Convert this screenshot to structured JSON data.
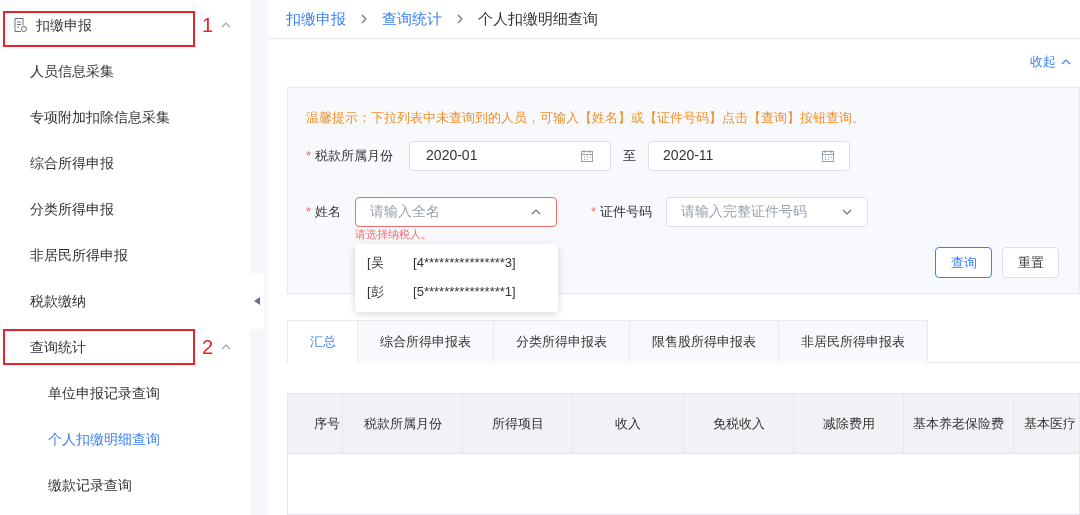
{
  "sidebar": {
    "items": [
      {
        "label": "扣缴申报",
        "expanded": true,
        "selected": false,
        "annotation": "1",
        "children": [
          {
            "label": "人员信息采集",
            "selected": false
          },
          {
            "label": "专项附加扣除信息采集",
            "selected": false
          },
          {
            "label": "综合所得申报",
            "selected": false
          },
          {
            "label": "分类所得申报",
            "selected": false
          },
          {
            "label": "非居民所得申报",
            "selected": false
          },
          {
            "label": "税款缴纳",
            "selected": false
          },
          {
            "label": "查询统计",
            "expanded": true,
            "selected": false,
            "annotation": "2",
            "children": [
              {
                "label": "单位申报记录查询",
                "selected": false
              },
              {
                "label": "个人扣缴明细查询",
                "selected": true
              },
              {
                "label": "缴款记录查询",
                "selected": false
              }
            ]
          }
        ]
      }
    ]
  },
  "breadcrumb": [
    {
      "label": "扣缴申报",
      "current": false
    },
    {
      "label": "查询统计",
      "current": false
    },
    {
      "label": "个人扣缴明细查询",
      "current": true
    }
  ],
  "collapse_link": "收起",
  "filter": {
    "tip": "温馨提示：下拉列表中未查询到的人员，可输入【姓名】或【证件号码】点击【查询】按钮查询。",
    "month": {
      "label": "税款所属月份",
      "required_mark": "*",
      "from": "2020-01",
      "separator": "至",
      "to": "2020-11"
    },
    "name": {
      "label": "姓名",
      "required_mark": "*",
      "placeholder": "请输入全名",
      "error": "请选择纳税人。",
      "expanded": true,
      "options": [
        {
          "name": "[吴",
          "id": "[4****************3]"
        },
        {
          "name": "[彭",
          "id": "[5****************1]"
        }
      ]
    },
    "id_number": {
      "label": "证件号码",
      "required_mark": "*",
      "placeholder": "请输入完整证件号码",
      "expanded": false
    },
    "buttons": [
      {
        "label": "查询",
        "primary": true
      },
      {
        "label": "重置",
        "primary": false
      }
    ]
  },
  "tabs": [
    {
      "label": "汇总",
      "selected": true
    },
    {
      "label": "综合所得申报表",
      "selected": false
    },
    {
      "label": "分类所得申报表",
      "selected": false
    },
    {
      "label": "限售股所得申报表",
      "selected": false
    },
    {
      "label": "非居民所得申报表",
      "selected": false
    }
  ],
  "table": {
    "columns": [
      "序号",
      "税款所属月份",
      "所得项目",
      "收入",
      "免税收入",
      "减除费用",
      "基本养老保险费",
      "基本医疗"
    ]
  }
}
